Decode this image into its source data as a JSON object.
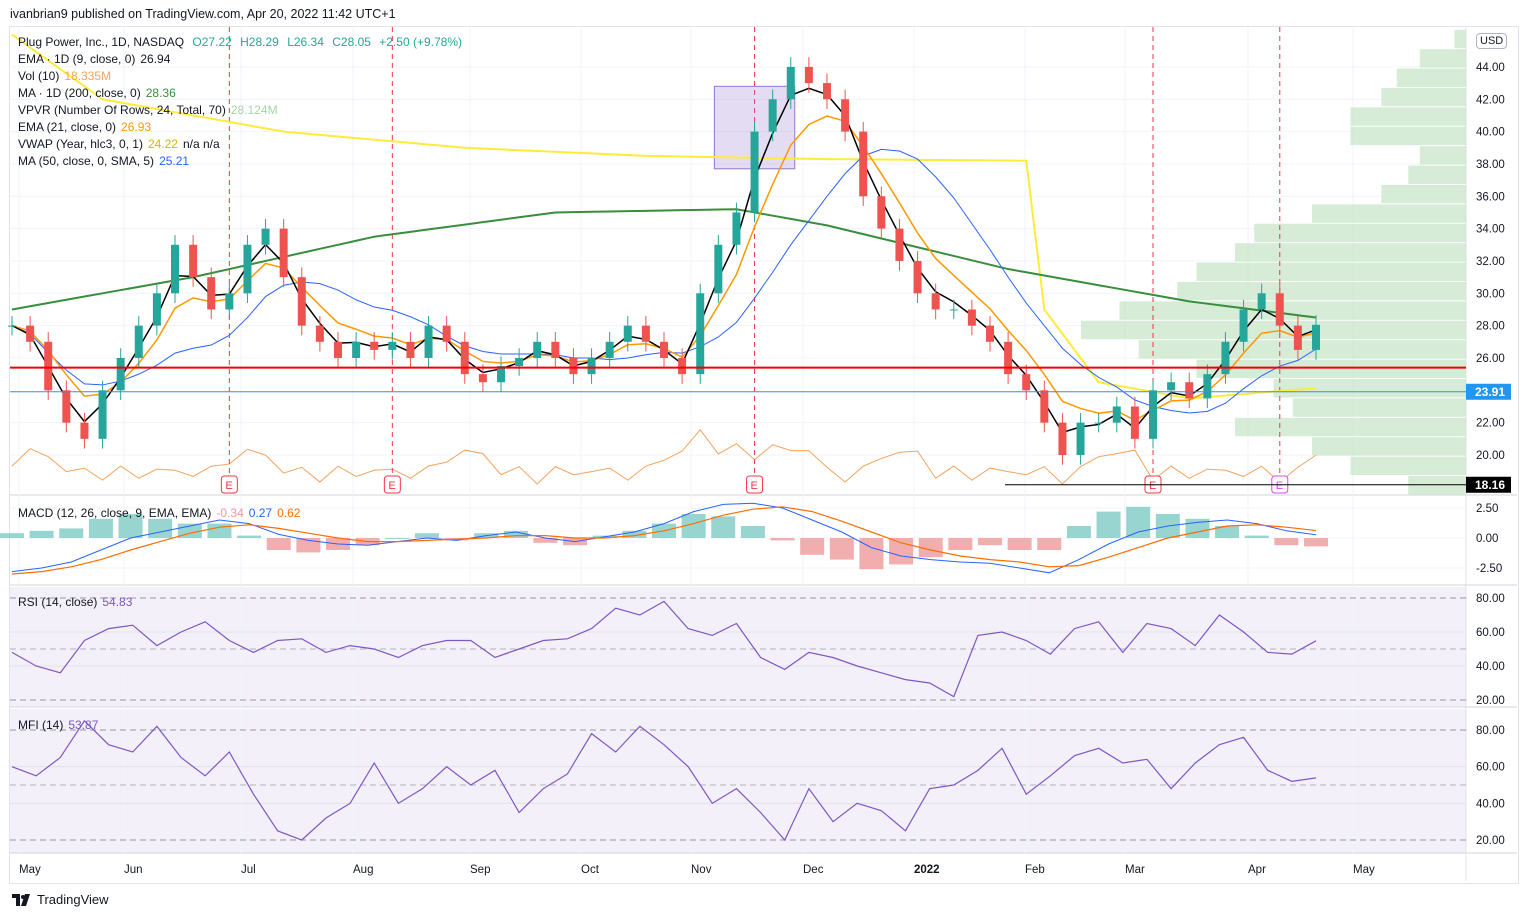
{
  "header": {
    "published": "ivanbrian9 published on TradingView.com, Apr 20, 2022 11:42 UTC+1"
  },
  "legend": {
    "symbol": "Plug Power, Inc., 1D, NASDAQ",
    "o": "O27.22",
    "h": "H28.29",
    "l": "L26.34",
    "c": "C28.05",
    "chg": "+2.50 (+9.78%)",
    "ema9": "EMA · 1D (9, close, 0)",
    "ema9_val": "26.94",
    "vol": "Vol (10)",
    "vol_val": "18.335M",
    "ma200": "MA · 1D (200, close, 0)",
    "ma200_val": "28.36",
    "vpvr": "VPVR (Number Of Rows, 24, Total, 70)",
    "vpvr_val": "28.124M",
    "ema21": "EMA (21, close, 0)",
    "ema21_val": "26.93",
    "vwap": "VWAP (Year, hlc3, 0, 1)",
    "vwap_val": "24.22",
    "vwap_na": "n/a  n/a",
    "ma50": "MA (50, close, 0, SMA, 5)",
    "ma50_val": "25.21",
    "macd": "MACD (12, 26, close, 9, EMA, EMA)",
    "macd_v1": "-0.34",
    "macd_v2": "0.27",
    "macd_v3": "0.62",
    "rsi": "RSI (14, close)",
    "rsi_val": "54.83",
    "mfi": "MFI (14)",
    "mfi_val": "53.87"
  },
  "currency": "USD",
  "footer": {
    "brand": "TradingView"
  },
  "colors": {
    "up": "#26a69a",
    "down": "#ef5350",
    "ema9": "#000000",
    "ema21": "#ff9800",
    "ma200": "#388e3c",
    "ma50": "#2962ff",
    "vwap": "#ffeb3b",
    "vol": "#f7a35c",
    "rsi": "#7e57c2"
  },
  "chart_data": {
    "type": "candlestick",
    "x_labels": [
      "May",
      "Jun",
      "Jul",
      "Aug",
      "Sep",
      "Oct",
      "Nov",
      "Dec",
      "2022",
      "Feb",
      "Mar",
      "Apr",
      "May"
    ],
    "price_ticks": [
      "44.00",
      "42.00",
      "40.00",
      "38.00",
      "36.00",
      "34.00",
      "32.00",
      "30.00",
      "28.00",
      "26.00",
      "22.00",
      "20.00"
    ],
    "price_range": [
      17.5,
      46.3
    ],
    "closes": [
      28,
      27,
      24,
      22,
      21,
      24,
      26,
      28,
      30,
      33,
      31,
      29,
      30,
      33,
      34,
      31,
      28,
      27,
      26,
      27,
      26.5,
      27,
      26,
      28,
      27,
      25,
      24.5,
      25.5,
      26,
      27,
      26,
      25,
      26,
      27,
      28,
      27,
      26,
      25,
      30,
      33,
      35,
      40,
      42,
      44,
      43,
      42,
      40,
      36,
      34,
      32,
      30,
      29,
      29,
      28,
      27,
      25,
      24,
      22,
      20,
      22,
      22,
      23,
      21,
      24,
      24.5,
      23.5,
      25,
      27,
      29,
      30,
      28,
      26.5,
      28.05
    ],
    "ma200": [
      [
        0,
        29
      ],
      [
        10,
        31
      ],
      [
        20,
        33.5
      ],
      [
        30,
        35
      ],
      [
        40,
        35.2
      ],
      [
        45,
        34.2
      ],
      [
        55,
        31.5
      ],
      [
        65,
        29.5
      ],
      [
        73,
        28.36
      ]
    ],
    "vwap": [
      [
        0,
        46
      ],
      [
        5,
        42
      ],
      [
        15,
        40
      ],
      [
        25,
        39
      ],
      [
        35,
        38.5
      ],
      [
        45,
        38.3
      ],
      [
        56,
        38.2
      ],
      [
        57,
        29
      ],
      [
        60,
        24.5
      ],
      [
        65,
        23.5
      ],
      [
        73,
        24.22
      ]
    ],
    "ema9_last": 26.94,
    "ema21_last": 26.93,
    "ma50_last": 25.21,
    "lines": {
      "red_level": 25.4,
      "blue_level": 23.91,
      "low_level": 18.16
    },
    "level_labels": {
      "blue": "23.91",
      "low": "18.16"
    },
    "box": {
      "from": 39,
      "to": 43,
      "low": 37.7,
      "high": 42.8
    },
    "earnings_marker": "E",
    "earnings_idx": [
      12,
      21,
      41,
      63,
      70
    ],
    "vpvr": [
      0.03,
      0.12,
      0.18,
      0.22,
      0.3,
      0.3,
      0.12,
      0.15,
      0.22,
      0.4,
      0.55,
      0.6,
      0.7,
      0.75,
      0.9,
      1.0,
      0.85,
      0.7,
      0.5,
      0.45,
      0.6,
      0.4,
      0.3,
      0.15
    ],
    "macd": {
      "ticks": [
        "2.50",
        "0.00",
        "-2.50"
      ],
      "range": [
        -3.2,
        3.2
      ],
      "macd": [
        -2.8,
        -2.5,
        -2,
        -1,
        0,
        0.5,
        1,
        1.5,
        1.2,
        0.3,
        -0.2,
        -0.5,
        -0.6,
        -0.3,
        0,
        -0.2,
        0.2,
        0.5,
        0,
        -0.3,
        0.1,
        0.5,
        1.2,
        2.2,
        2.8,
        2.9,
        2.5,
        1.5,
        0.5,
        -0.8,
        -1.5,
        -1.8,
        -2,
        -2.1,
        -2.5,
        -2.9,
        -1.8,
        -0.5,
        0.5,
        1,
        1.3,
        1.5,
        1.2,
        0.6,
        0.27
      ],
      "signal": [
        -3,
        -2.8,
        -2.4,
        -1.8,
        -1,
        -0.3,
        0.4,
        0.9,
        1.1,
        0.8,
        0.4,
        0,
        -0.3,
        -0.3,
        -0.2,
        -0.1,
        0,
        0.2,
        0.2,
        0,
        0,
        0.2,
        0.6,
        1.2,
        1.9,
        2.4,
        2.6,
        2.2,
        1.4,
        0.5,
        -0.4,
        -1,
        -1.5,
        -1.8,
        -2,
        -2.4,
        -2.3,
        -1.6,
        -0.8,
        0,
        0.5,
        1,
        1.1,
        0.9,
        0.62
      ]
    },
    "rsi": {
      "ticks": [
        "80.00",
        "60.00",
        "40.00",
        "20.00"
      ],
      "values": [
        48,
        40,
        36,
        55,
        62,
        64,
        52,
        60,
        66,
        55,
        48,
        55,
        56,
        48,
        52,
        50,
        45,
        52,
        55,
        55,
        45,
        50,
        55,
        56,
        62,
        74,
        70,
        78,
        62,
        58,
        65,
        45,
        38,
        48,
        45,
        40,
        36,
        32,
        30,
        22,
        58,
        60,
        55,
        47,
        62,
        66,
        48,
        65,
        62,
        52,
        70,
        60,
        48,
        47,
        54.83
      ]
    },
    "mfi": {
      "ticks": [
        "80.00",
        "60.00",
        "40.00",
        "20.00"
      ],
      "values": [
        60,
        55,
        65,
        85,
        72,
        68,
        82,
        65,
        55,
        68,
        45,
        25,
        20,
        32,
        40,
        62,
        40,
        48,
        60,
        50,
        58,
        35,
        48,
        56,
        78,
        68,
        82,
        72,
        60,
        40,
        48,
        35,
        20,
        48,
        30,
        40,
        36,
        25,
        48,
        50,
        58,
        70,
        45,
        55,
        66,
        70,
        62,
        64,
        48,
        62,
        72,
        76,
        58,
        52,
        53.87
      ]
    }
  }
}
